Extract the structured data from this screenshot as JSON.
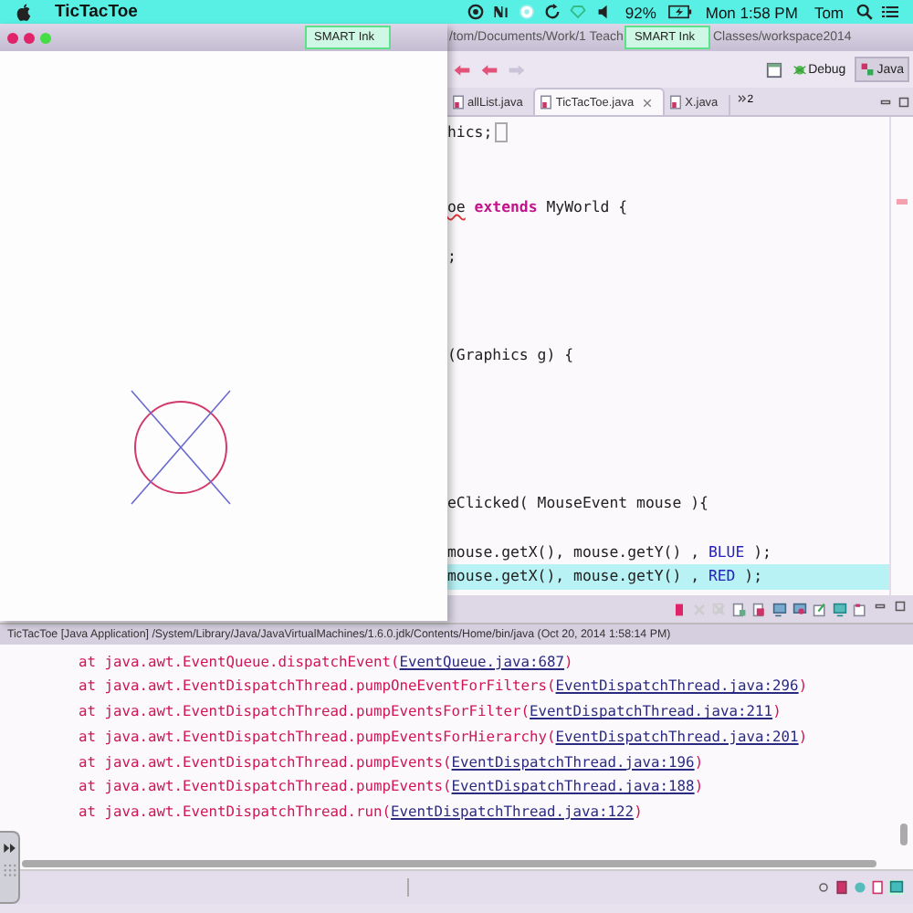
{
  "menu_bar": {
    "app_name": "TicTacToe",
    "battery": "92%",
    "clock": "Mon 1:58 PM",
    "user": "Tom"
  },
  "app_window": {
    "smart_ink_badge": "SMART Ink"
  },
  "ide": {
    "title_path_start": "/tom/Documents/Work/1 Teach",
    "smart_ink_badge": "SMART Ink",
    "title_path_end": "Classes/workspace2014",
    "perspectives": [
      {
        "label": "Debug",
        "selected": false
      },
      {
        "label": "Java",
        "selected": true
      }
    ],
    "editor_tabs": [
      {
        "label": "allList.java",
        "selected": false
      },
      {
        "label": "TicTacToe.java",
        "selected": true
      },
      {
        "label": "X.java",
        "selected": false
      }
    ],
    "hidden_tab_count": "2",
    "code_lines": [
      {
        "kind": "code",
        "highlighted": false,
        "bracket_box": true,
        "segments": [
          {
            "kind": "plain",
            "text": "hics;"
          }
        ]
      },
      {
        "kind": "blank"
      },
      {
        "kind": "blank"
      },
      {
        "kind": "code",
        "highlighted": false,
        "bracket_box": false,
        "segments": [
          {
            "kind": "error",
            "text": "oe"
          },
          {
            "kind": "keyword",
            "text": "extends"
          },
          {
            "kind": "plain",
            "text": " MyWorld {"
          }
        ]
      },
      {
        "kind": "blank"
      },
      {
        "kind": "code",
        "highlighted": false,
        "bracket_box": false,
        "segments": [
          {
            "kind": "plain",
            "text": ";"
          }
        ]
      },
      {
        "kind": "blank"
      },
      {
        "kind": "blank"
      },
      {
        "kind": "blank"
      },
      {
        "kind": "code",
        "highlighted": false,
        "bracket_box": false,
        "segments": [
          {
            "kind": "plain",
            "text": "(Graphics g) {"
          }
        ]
      },
      {
        "kind": "blank"
      },
      {
        "kind": "blank"
      },
      {
        "kind": "blank"
      },
      {
        "kind": "blank"
      },
      {
        "kind": "blank"
      },
      {
        "kind": "code",
        "highlighted": false,
        "bracket_box": false,
        "segments": [
          {
            "kind": "plain",
            "text": "eClicked( MouseEvent mouse ){"
          }
        ]
      },
      {
        "kind": "blank"
      },
      {
        "kind": "code",
        "highlighted": false,
        "bracket_box": false,
        "segments": [
          {
            "kind": "plain",
            "text": "mouse.getX(), mouse.getY() , "
          },
          {
            "kind": "constant",
            "text": "BLUE"
          },
          {
            "kind": "plain",
            "text": " );"
          }
        ]
      },
      {
        "kind": "code",
        "highlighted": true,
        "bracket_box": false,
        "segments": [
          {
            "kind": "plain",
            "text": "mouse.getX(), mouse.getY() , "
          },
          {
            "kind": "constant",
            "text": "RED"
          },
          {
            "kind": "plain",
            "text": " );"
          }
        ]
      }
    ],
    "console": {
      "header": "TicTacToe [Java Application] /System/Library/Java/JavaVirtualMachines/1.6.0.jdk/Contents/Home/bin/java (Oct 20, 2014 1:58:14 PM)",
      "lines": [
        {
          "prefix": "at java.awt.EventQueue.dispatchEvent(",
          "link": "EventQueue.java:687",
          "suffix": ")"
        },
        {
          "prefix": "at java.awt.EventDispatchThread.pumpOneEventForFilters(",
          "link": "EventDispatchThread.java:296",
          "suffix": ")"
        },
        {
          "prefix": "at java.awt.EventDispatchThread.pumpEventsForFilter(",
          "link": "EventDispatchThread.java:211",
          "suffix": ")"
        },
        {
          "prefix": "at java.awt.EventDispatchThread.pumpEventsForHierarchy(",
          "link": "EventDispatchThread.java:201",
          "suffix": ")"
        },
        {
          "prefix": "at java.awt.EventDispatchThread.pumpEvents(",
          "link": "EventDispatchThread.java:196",
          "suffix": ")"
        },
        {
          "prefix": "at java.awt.EventDispatchThread.pumpEvents(",
          "link": "EventDispatchThread.java:188",
          "suffix": ")"
        },
        {
          "prefix": "at java.awt.EventDispatchThread.run(",
          "link": "EventDispatchThread.java:122",
          "suffix": ")"
        }
      ]
    }
  }
}
